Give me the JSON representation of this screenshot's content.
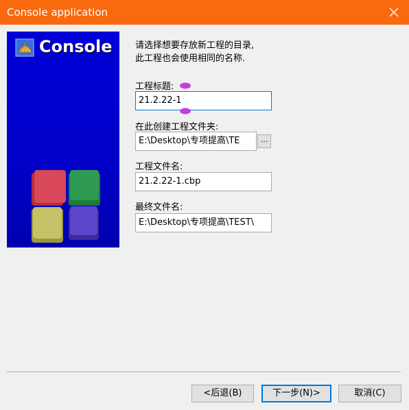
{
  "window": {
    "title": "Console application",
    "close_icon": "close-icon",
    "accent_color": "#f96a0e"
  },
  "banner": {
    "logo_text": "Console",
    "logo_icon": "shell-icon",
    "cubes_icon": "colored-cubes-icon"
  },
  "instructions": {
    "line1": "请选择想要存放新工程的目录,",
    "line2": "此工程也会使用相同的名称."
  },
  "form": {
    "project_title_label": "工程标题:",
    "project_title_value": "21.2.22-1",
    "folder_label": "在此创建工程文件夹:",
    "folder_value": "E:\\Desktop\\专项提高\\TE",
    "browse_label": "...",
    "project_file_label": "工程文件名:",
    "project_file_value": "21.2.22-1.cbp",
    "result_label": "最终文件名:",
    "result_value": "E:\\Desktop\\专项提高\\TEST\\"
  },
  "buttons": {
    "back": "<后退(B)",
    "next": "下一步(N)>",
    "cancel": "取消(C)"
  }
}
